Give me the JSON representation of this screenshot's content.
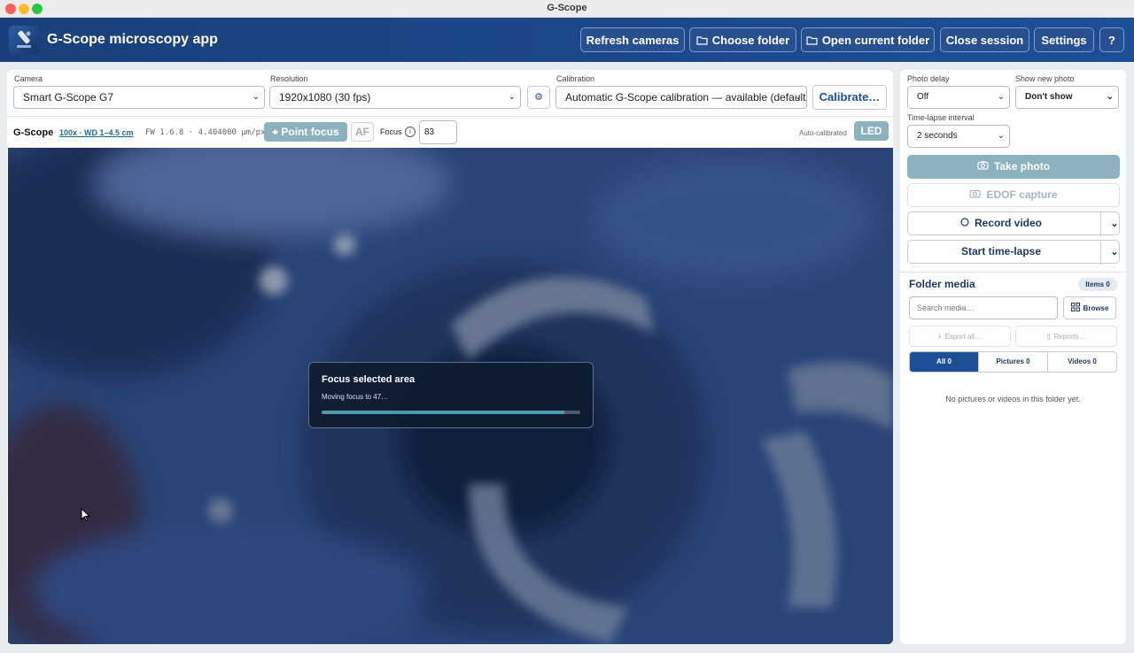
{
  "window": {
    "title": "G-Scope"
  },
  "header": {
    "app_title": "G-Scope microscopy app",
    "refresh": "Refresh cameras",
    "choose_folder": "Choose folder",
    "open_folder": "Open current folder",
    "close_session": "Close session",
    "settings": "Settings",
    "help": "?"
  },
  "controls": {
    "camera_label": "Camera",
    "camera_value": "Smart G-Scope G7",
    "resolution_label": "Resolution",
    "resolution_value": "1920x1080 (30 fps)",
    "calibration_label": "Calibration",
    "calibration_value": "Automatic G-Scope calibration — available (default)",
    "calibrate_button": "Calibrate…"
  },
  "infobar": {
    "brand": "G-Scope",
    "lens": "100x · WD 1–4.5 cm",
    "firmware": "FW 1.6.8 · 4.404000 µm/px",
    "point_focus": "Point focus",
    "af": "AF",
    "focus_label": "Focus",
    "focus_value": "83",
    "auto_calibrated": "Auto-calibrated",
    "led": "LED"
  },
  "modal": {
    "title": "Focus selected area",
    "subtitle": "Moving focus to 47…",
    "progress": 0.94
  },
  "right": {
    "photo_delay_label": "Photo delay",
    "photo_delay_value": "Off",
    "show_new_photo_label": "Show new photo",
    "show_new_photo_value": "Don't show",
    "timelapse_label": "Time-lapse interval",
    "timelapse_value": "2 seconds",
    "take_photo": "Take photo",
    "edof": "EDOF capture",
    "record_video": "Record video",
    "start_timelapse": "Start time-lapse",
    "folder_media": "Folder media",
    "items_badge": "Items 0",
    "search_placeholder": "Search media…",
    "browse": "Browse",
    "export_all": "Export all…",
    "reports": "Reports…",
    "tabs": [
      {
        "label": "All 0"
      },
      {
        "label": "Pictures 0"
      },
      {
        "label": "Videos 0"
      }
    ],
    "empty_text": "No pictures or videos in this folder yet."
  },
  "colors": {
    "accent": "#1d4f96",
    "muted_button": "#8cb2bd",
    "header": "#1a3f7c"
  }
}
